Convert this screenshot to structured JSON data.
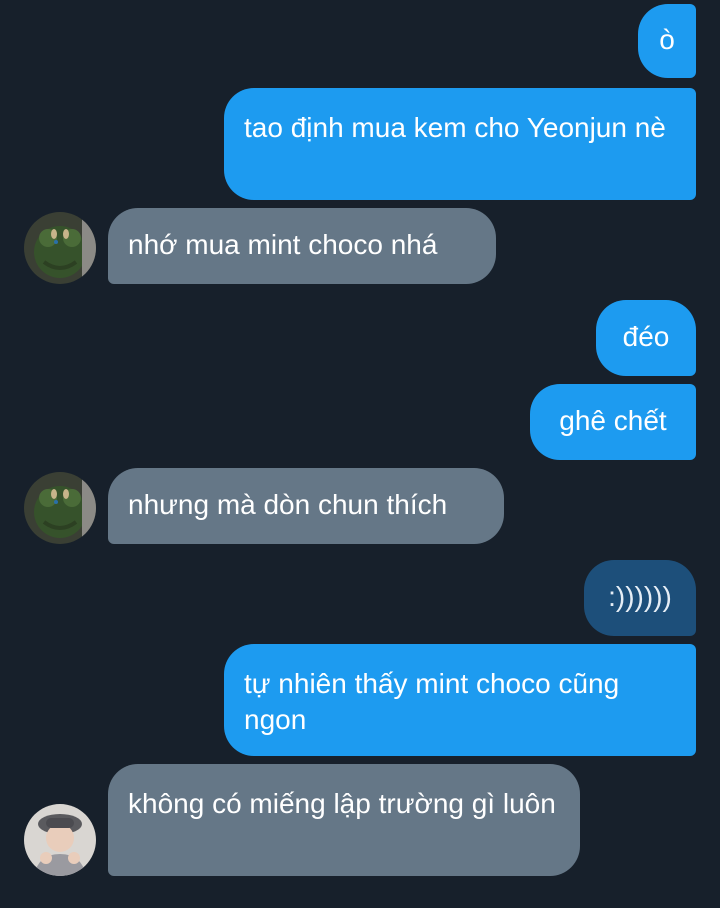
{
  "messages": [
    {
      "id": "m1",
      "direction": "outgoing",
      "text": "ò"
    },
    {
      "id": "m2",
      "direction": "outgoing",
      "text": "tao định mua kem cho Yeonjun nè"
    },
    {
      "id": "m3",
      "direction": "incoming",
      "text": "nhớ mua mint choco nhá",
      "avatar": "green-plush-avatar"
    },
    {
      "id": "m4",
      "direction": "outgoing",
      "text": "đéo"
    },
    {
      "id": "m5",
      "direction": "outgoing",
      "text": "ghê chết"
    },
    {
      "id": "m6",
      "direction": "incoming",
      "text": "nhưng mà dòn chun thích",
      "avatar": "green-plush-avatar"
    },
    {
      "id": "m7",
      "direction": "outgoing",
      "text": ":))))))",
      "state": "highlighted"
    },
    {
      "id": "m8",
      "direction": "outgoing",
      "text": "tự nhiên thấy mint choco cũng ngon"
    },
    {
      "id": "m9",
      "direction": "incoming",
      "text": "không có miếng lập trường gì luôn",
      "avatar": "person-photo-avatar"
    }
  ],
  "colors": {
    "background": "#17202b",
    "outgoing_bubble": "#1d9bf0",
    "outgoing_bubble_highlighted": "#1d4f7a",
    "incoming_bubble": "#657787"
  }
}
